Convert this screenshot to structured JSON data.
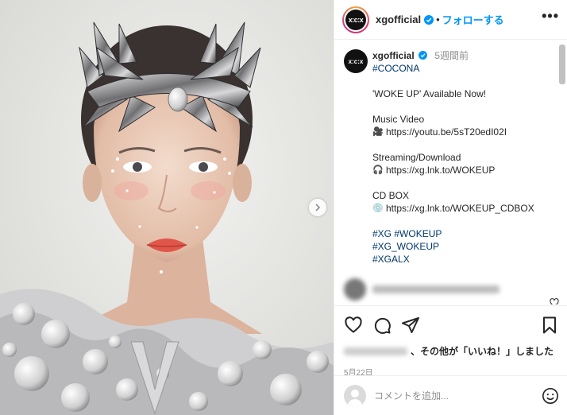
{
  "post": {
    "username": "xgofficial",
    "avatar_text": "x:c:x",
    "follow_label": "フォローする",
    "dot": "•",
    "more_label": "•••"
  },
  "caption": {
    "username": "xgofficial",
    "time": "5週間前",
    "lines": {
      "hashtag_corona": "#COCONA",
      "headline": "'WOKE UP' Available Now!",
      "mv_title": "Music Video",
      "mv_link": "https://youtu.be/5sT20edI02I",
      "streaming_title": "Streaming/Download",
      "streaming_link": "https://xg.lnk.to/WOKEUP",
      "cd_title": "CD BOX",
      "cd_link": "https://xg.lnk.to/WOKEUP_CDBOX",
      "tag1": "#XG",
      "tag2": "#WOKEUP",
      "tag3": "#XG_WOKEUP",
      "tag4": "#XGALX"
    },
    "icons": {
      "mv": "movie-camera-icon",
      "streaming": "headphones-icon",
      "cd": "cd-icon"
    }
  },
  "likes": {
    "suffix": "、その他が「いいね！」しました"
  },
  "date": "5月22日",
  "comment": {
    "placeholder": "コメントを追加..."
  },
  "colors": {
    "link": "#00376b",
    "follow": "#0095f6",
    "muted": "#8e8e8e"
  }
}
